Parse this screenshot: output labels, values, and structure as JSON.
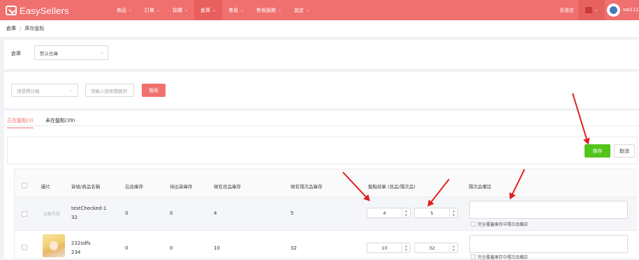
{
  "header": {
    "brand": "EasySellers",
    "nav": [
      {
        "label": "商品",
        "active": false
      },
      {
        "label": "訂單",
        "active": false
      },
      {
        "label": "採購",
        "active": false
      },
      {
        "label": "倉庫",
        "active": true
      },
      {
        "label": "會員",
        "active": false
      },
      {
        "label": "售後服務",
        "active": false
      },
      {
        "label": "設定",
        "active": false
      }
    ],
    "help": "多語言",
    "username": "sw111"
  },
  "breadcrumb": {
    "root": "倉庫",
    "sep": "/",
    "current": "庫存盤點"
  },
  "warehouse": {
    "label": "倉庫",
    "value": "默认仓庫"
  },
  "filter": {
    "category_placeholder": "請選擇分類",
    "search_placeholder": "請輸入搜索關鍵詞",
    "search_button": "搜索"
  },
  "tabs": [
    {
      "label": "正在盤點(3)",
      "active": true
    },
    {
      "label": "未在盤點(39)",
      "active": false
    }
  ],
  "actions": {
    "save": "保存",
    "cancel": "取消"
  },
  "table": {
    "headers": [
      "圖片",
      "貨號/商品名稱",
      "在途庫存",
      "待出貨庫存",
      "現有良品庫存",
      "現有殘次品庫存",
      "盤點結果 (良品/殘次品)",
      "殘次品備註"
    ],
    "rows": [
      {
        "image_text": "加載失敗",
        "sku": "testChecked-1",
        "name": "32",
        "in_transit": "0",
        "pending": "0",
        "good": "4",
        "defective": "5",
        "count_good": "4",
        "count_defective": "5",
        "note_checkbox": "完全覆蓋庫存中殘次品備註"
      },
      {
        "image_text": "",
        "sku": "232sdfs",
        "name": "234",
        "in_transit": "0",
        "pending": "0",
        "good": "10",
        "defective": "32",
        "count_good": "10",
        "count_defective": "32",
        "note_checkbox": "完全覆蓋庫存中殘次品備註"
      }
    ]
  },
  "colors": {
    "brand": "#f0706f",
    "save": "#52c41a",
    "annotation": "#e02020"
  }
}
